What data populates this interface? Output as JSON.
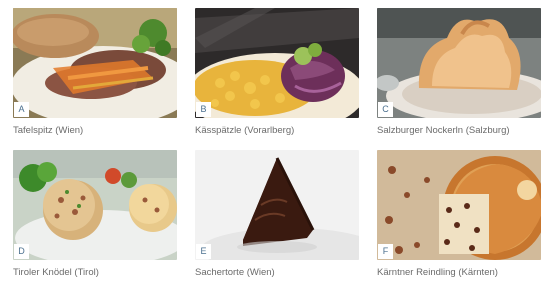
{
  "dishes": [
    {
      "letter": "A",
      "caption": "Tafelspitz (Wien)"
    },
    {
      "letter": "B",
      "caption": "Kässpätzle (Vorarlberg)"
    },
    {
      "letter": "C",
      "caption": "Salzburger Nockerln (Salzburg)"
    },
    {
      "letter": "D",
      "caption": "Tiroler Knödel (Tirol)"
    },
    {
      "letter": "E",
      "caption": "Sachertorte (Wien)"
    },
    {
      "letter": "F",
      "caption": "Kärntner Reindling (Kärnten)"
    }
  ],
  "colors": {
    "caption_text": "#6b6b6b",
    "letter_text": "#4a6f8e",
    "letter_box": "#ffffff"
  }
}
